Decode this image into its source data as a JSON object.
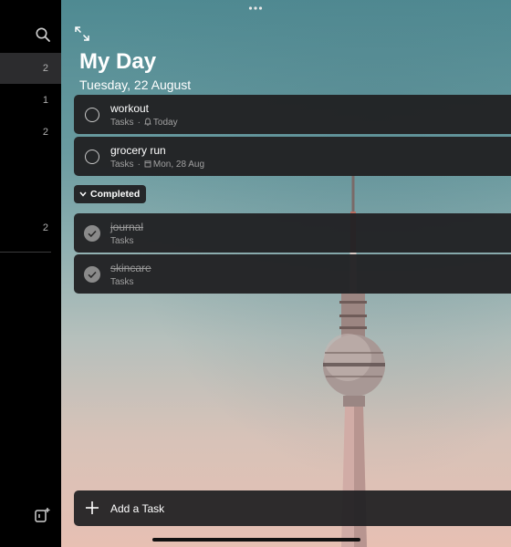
{
  "sidebar": {
    "counts": [
      {
        "value": "2",
        "active": true
      },
      {
        "value": "1",
        "active": false
      },
      {
        "value": "2",
        "active": false
      },
      {
        "value": "2",
        "active": false
      }
    ]
  },
  "header": {
    "title": "My Day",
    "date": "Tuesday, 22 August"
  },
  "tasks": [
    {
      "title": "workout",
      "list": "Tasks",
      "due": "Today",
      "due_icon": "bell-icon"
    },
    {
      "title": "grocery run",
      "list": "Tasks",
      "due": "Mon, 28 Aug",
      "due_icon": "calendar-icon"
    }
  ],
  "completed_label": "Completed",
  "completed_tasks": [
    {
      "title": "journal",
      "list": "Tasks"
    },
    {
      "title": "skincare",
      "list": "Tasks"
    }
  ],
  "add_task": {
    "label": "Add a Task"
  },
  "colors": {
    "sidebar": "#000000",
    "active_row": "#2c2c2e",
    "card": "#212123"
  }
}
